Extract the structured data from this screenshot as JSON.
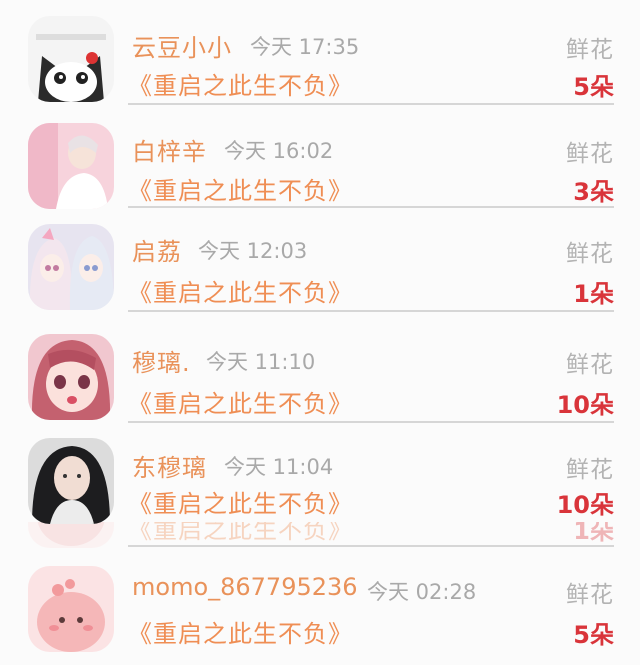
{
  "rows": [
    {
      "name": "云豆小小",
      "time": "今天 17:35",
      "title": "《重启之此生不负》",
      "gift": "鲜花",
      "count": "5朵",
      "avatar": "cat-avatar"
    },
    {
      "name": "白梓辛",
      "time": "今天 16:02",
      "title": "《重启之此生不负》",
      "gift": "鲜花",
      "count": "3朵",
      "avatar": "pink-girl-avatar"
    },
    {
      "name": "启荔",
      "time": "今天 12:03",
      "title": "《重启之此生不负》",
      "gift": "鲜花",
      "count": "1朵",
      "avatar": "anime-pair-avatar"
    },
    {
      "name": "穆璃.",
      "time": "今天 11:10",
      "title": "《重启之此生不负》",
      "gift": "鲜花",
      "count": "10朵",
      "avatar": "anime-girl-avatar"
    },
    {
      "name": "东穆璃",
      "time": "今天 11:04",
      "title": "《重启之此生不负》",
      "gift": "鲜花",
      "count": "10朵",
      "avatar": "photo-girl-avatar"
    },
    {
      "name": "",
      "time": "",
      "title": "《重启之此生不负》",
      "gift": "",
      "count": "1朵",
      "avatar": "pink-blob-avatar"
    },
    {
      "name": "momo_867795236",
      "time": "今天 02:28",
      "title": "《重启之此生不负》",
      "gift": "鲜花",
      "count": "5朵",
      "avatar": "pink-blob-avatar"
    }
  ]
}
